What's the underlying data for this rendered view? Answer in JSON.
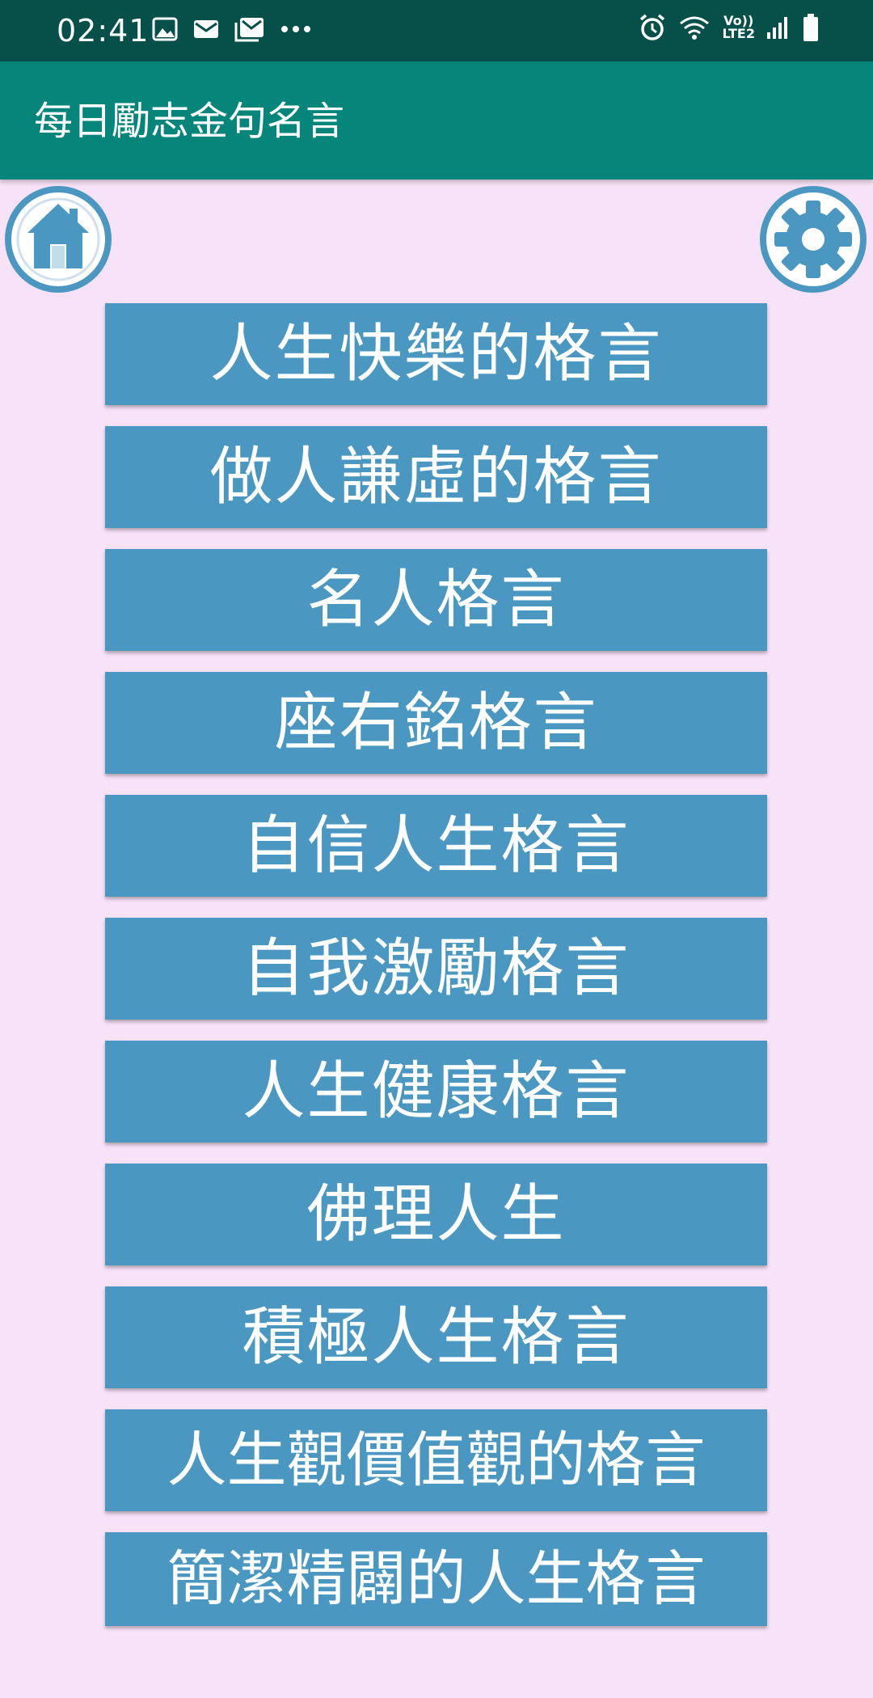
{
  "status_bar": {
    "time": "02:41",
    "left_icons": [
      "image-icon",
      "mail-icon",
      "gallery-mail-icon",
      "more-dots-icon"
    ],
    "right_icons": [
      "alarm-icon",
      "wifi-icon",
      "volte-lte2-icon",
      "signal-icon",
      "battery-icon"
    ],
    "volte_label": "Vo))",
    "lte_label": "LTE2"
  },
  "app_bar": {
    "title": "每日勵志金句名言"
  },
  "toolbar": {
    "home_icon": "home-icon",
    "settings_icon": "gear-icon"
  },
  "menu": {
    "items": [
      {
        "label": "人生快樂的格言"
      },
      {
        "label": "做人謙虛的格言"
      },
      {
        "label": "名人格言"
      },
      {
        "label": "座右銘格言"
      },
      {
        "label": "自信人生格言"
      },
      {
        "label": "自我激勵格言"
      },
      {
        "label": "人生健康格言"
      },
      {
        "label": "佛理人生"
      },
      {
        "label": "積極人生格言"
      },
      {
        "label": "人生觀價值觀的格言"
      },
      {
        "label": "簡潔精闢的人生格言"
      }
    ]
  },
  "colors": {
    "status_bar": "#065049",
    "app_bar": "#06857a",
    "background": "#f8e2f7",
    "button": "#4a97c1",
    "icon_blue": "#4a97c1"
  }
}
